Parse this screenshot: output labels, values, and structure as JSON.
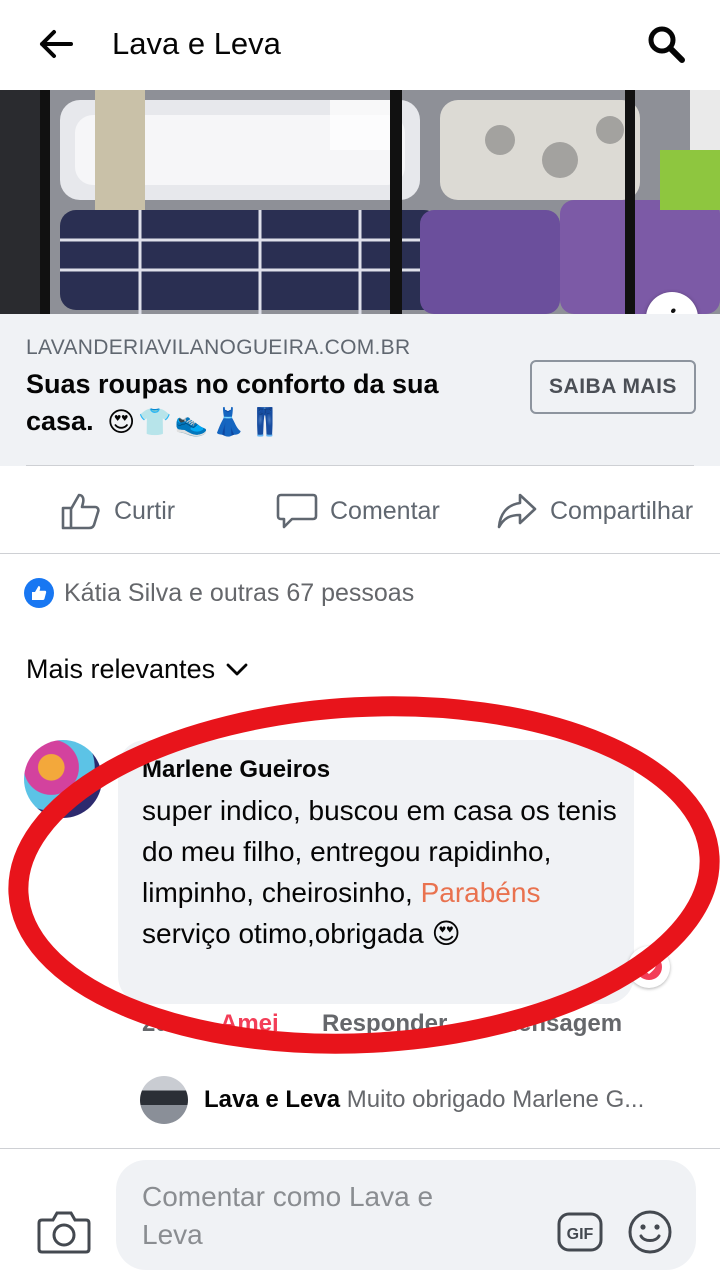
{
  "header": {
    "title": "Lava e Leva",
    "back_icon": "back-arrow-icon",
    "search_icon": "search-icon"
  },
  "ad": {
    "info_label": "i",
    "domain": "LAVANDERIAVILANOGUEIRA.COM.BR",
    "headline": "Suas roupas no conforto da sua casa.",
    "headline_emojis": [
      "😍",
      "👕",
      "👟",
      "👗",
      "👖"
    ],
    "cta_label": "SAIBA MAIS"
  },
  "actions": {
    "like": "Curtir",
    "comment": "Comentar",
    "share": "Compartilhar"
  },
  "reactions": {
    "text": "Kátia Silva e outras 67 pessoas",
    "icon": "like-reaction-icon"
  },
  "sort": {
    "label": "Mais relevantes"
  },
  "comment": {
    "author": "Marlene Gueiros",
    "text_before": "super indico, buscou em casa os tenis do meu filho, entregou rapidinho, limpinho, cheirosinho, ",
    "highlight": "Parabéns",
    "text_after": " serviço otimo,obrigada ",
    "emoji": "😍",
    "reaction_icon": "heart-reaction-icon",
    "actions": {
      "time": "2d",
      "reacted": "Amei",
      "reply": "Responder",
      "message": "Mensagem"
    }
  },
  "reply": {
    "author": "Lava e Leva",
    "text": "Muito obrigado Marlene G..."
  },
  "composer": {
    "placeholder": "Comentar como Lava e Leva",
    "gif_label": "GIF"
  },
  "colors": {
    "brand_blue": "#1877f2",
    "highlight_orange": "#e9724f",
    "love_red": "#f33e58",
    "annotation_red": "#e8141b"
  }
}
